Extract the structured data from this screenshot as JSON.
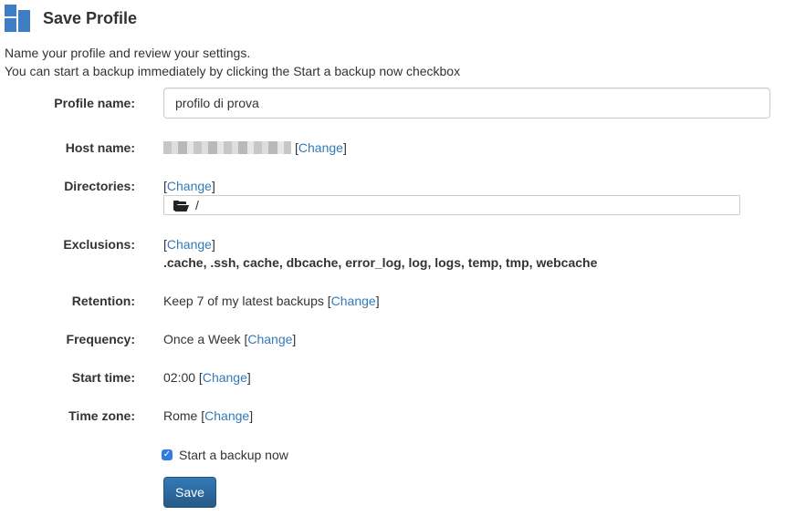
{
  "header": {
    "title": "Save Profile",
    "logo_color": "#3d7ec5"
  },
  "intro": {
    "line1": "Name your profile and review your settings.",
    "line2": "You can start a backup immediately by clicking the Start a backup now checkbox"
  },
  "form": {
    "profile_name": {
      "label": "Profile name:",
      "value": "profilo di prova"
    },
    "host_name": {
      "label": "Host name:",
      "change": "Change"
    },
    "directories": {
      "label": "Directories:",
      "change": "Change",
      "path": "/"
    },
    "exclusions": {
      "label": "Exclusions:",
      "change": "Change",
      "list": ".cache, .ssh, cache, dbcache, error_log, log, logs, temp, tmp, webcache"
    },
    "retention": {
      "label": "Retention:",
      "value": "Keep 7 of my latest backups",
      "change": "Change"
    },
    "frequency": {
      "label": "Frequency:",
      "value": "Once a Week",
      "change": "Change"
    },
    "start_time": {
      "label": "Start time:",
      "value": "02:00",
      "change": "Change"
    },
    "time_zone": {
      "label": "Time zone:",
      "value": "Rome",
      "change": "Change"
    },
    "start_backup": {
      "label": "Start a backup now",
      "checked": true
    },
    "save_label": "Save"
  },
  "colors": {
    "link": "#337ab7",
    "button": "#337ab7",
    "checkbox": "#2f7de1"
  }
}
